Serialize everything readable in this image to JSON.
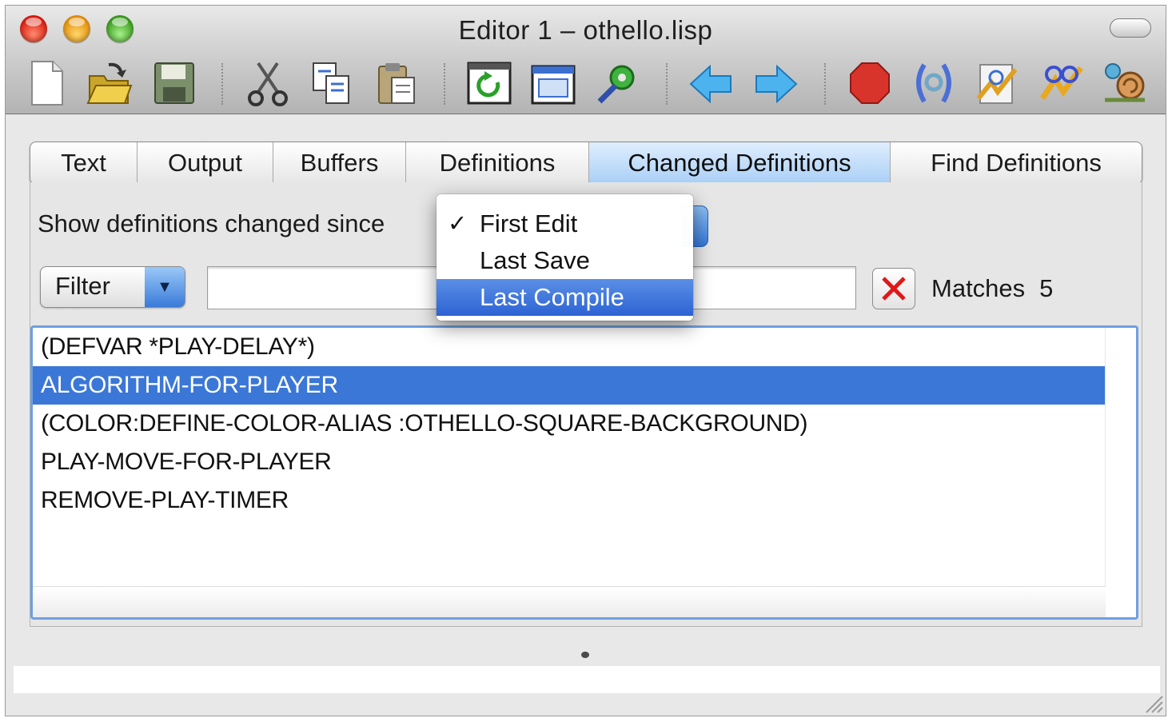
{
  "window": {
    "title": "Editor 1 – othello.lisp"
  },
  "toolbar": {
    "buttons": [
      {
        "icon": "new-file-icon"
      },
      {
        "icon": "open-folder-icon"
      },
      {
        "icon": "save-disk-icon"
      },
      {
        "icon": "cut-scissors-icon"
      },
      {
        "icon": "copy-icon"
      },
      {
        "icon": "paste-icon"
      },
      {
        "icon": "refresh-window-icon"
      },
      {
        "icon": "new-window-icon"
      },
      {
        "icon": "tools-gear-icon"
      },
      {
        "icon": "back-arrow-icon"
      },
      {
        "icon": "forward-arrow-icon"
      },
      {
        "icon": "stop-icon"
      },
      {
        "icon": "inspect-icon"
      },
      {
        "icon": "compile-icon"
      },
      {
        "icon": "compile-buffer-icon"
      },
      {
        "icon": "snail-icon"
      }
    ]
  },
  "tabs": [
    {
      "label": "Text"
    },
    {
      "label": "Output"
    },
    {
      "label": "Buffers"
    },
    {
      "label": "Definitions"
    },
    {
      "label": "Changed Definitions",
      "active": true
    },
    {
      "label": "Find Definitions"
    }
  ],
  "panel": {
    "since_label": "Show definitions changed since",
    "filter_label": "Filter",
    "filter_value": "",
    "matches_label": "Matches",
    "matches_count": "5"
  },
  "definitions": [
    {
      "text": "(DEFVAR *PLAY-DELAY*)",
      "selected": false
    },
    {
      "text": "ALGORITHM-FOR-PLAYER",
      "selected": true
    },
    {
      "text": "(COLOR:DEFINE-COLOR-ALIAS :OTHELLO-SQUARE-BACKGROUND)",
      "selected": false
    },
    {
      "text": "PLAY-MOVE-FOR-PLAYER",
      "selected": false
    },
    {
      "text": "REMOVE-PLAY-TIMER",
      "selected": false
    }
  ],
  "since_menu": {
    "items": [
      {
        "label": "First Edit",
        "checked": true,
        "highlighted": false
      },
      {
        "label": "Last Save",
        "checked": false,
        "highlighted": false
      },
      {
        "label": "Last Compile",
        "checked": false,
        "highlighted": true
      }
    ],
    "check_glyph": "✓"
  },
  "colors": {
    "selection": "#3b77d6",
    "active_tab": "#a9cff6",
    "focus_ring": "#6f9fe0"
  }
}
